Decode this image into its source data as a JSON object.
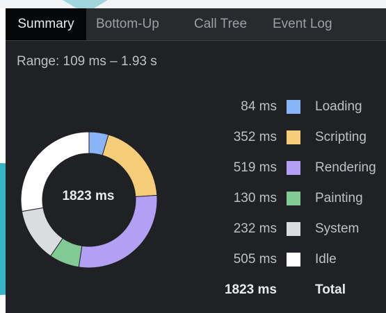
{
  "tabs": [
    {
      "label": "Summary",
      "active": true
    },
    {
      "label": "Bottom-Up",
      "active": false
    },
    {
      "label": "Call Tree",
      "active": false
    },
    {
      "label": "Event Log",
      "active": false
    }
  ],
  "range": "Range: 109 ms – 1.93 s",
  "donut_center": "1823 ms",
  "categories": [
    {
      "value": "84 ms",
      "ms": 84,
      "label": "Loading",
      "color": "#8ab4f8"
    },
    {
      "value": "352 ms",
      "ms": 352,
      "label": "Scripting",
      "color": "#f5cd79"
    },
    {
      "value": "519 ms",
      "ms": 519,
      "label": "Rendering",
      "color": "#b39ff3"
    },
    {
      "value": "130 ms",
      "ms": 130,
      "label": "Painting",
      "color": "#81c995"
    },
    {
      "value": "232 ms",
      "ms": 232,
      "label": "System",
      "color": "#dadce0"
    },
    {
      "value": "505 ms",
      "ms": 505,
      "label": "Idle",
      "color": "#ffffff"
    }
  ],
  "total": {
    "value": "1823 ms",
    "label": "Total"
  }
}
